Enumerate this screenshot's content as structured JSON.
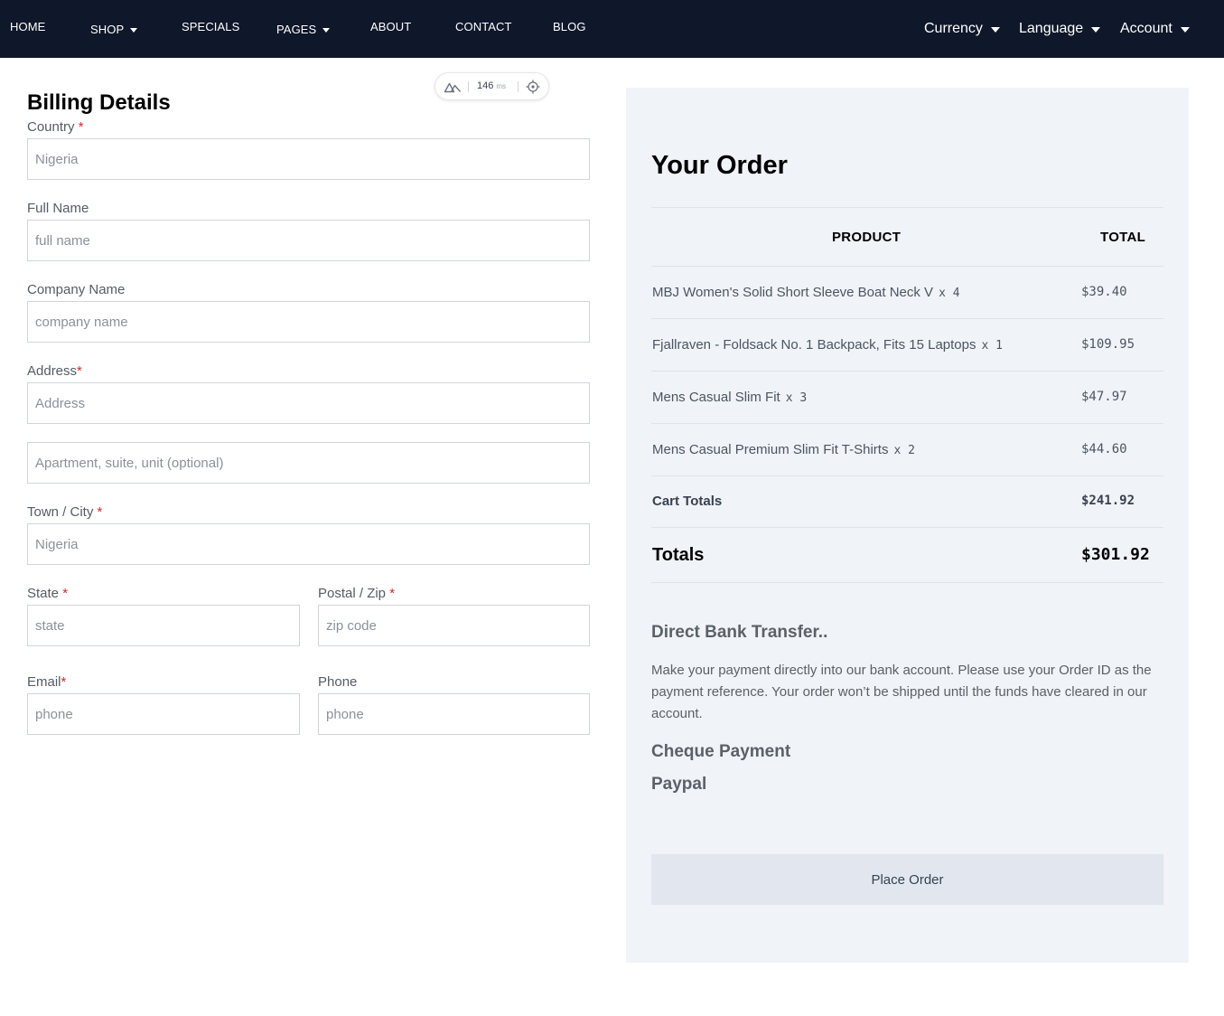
{
  "nav": {
    "items": [
      {
        "label": "HOME",
        "has_dropdown": false
      },
      {
        "label": "SHOP",
        "has_dropdown": true
      },
      {
        "label": "SPECIALS",
        "has_dropdown": false
      },
      {
        "label": "PAGES",
        "has_dropdown": true
      },
      {
        "label": "ABOUT",
        "has_dropdown": false
      },
      {
        "label": "CONTACT",
        "has_dropdown": false
      },
      {
        "label": "BLOG",
        "has_dropdown": false
      }
    ],
    "right": [
      {
        "label": "Currency"
      },
      {
        "label": "Language"
      },
      {
        "label": "Account"
      }
    ]
  },
  "devtools": {
    "timing_value": "146",
    "timing_unit": "ms"
  },
  "billing": {
    "title": "Billing Details",
    "country": {
      "label": "Country",
      "required_mark": "*",
      "placeholder": "Nigeria"
    },
    "full_name": {
      "label": "Full Name",
      "placeholder": "full name"
    },
    "company": {
      "label": "Company Name",
      "placeholder": "company name"
    },
    "address": {
      "label": "Address",
      "required_mark": "*",
      "placeholder": "Address",
      "line2_placeholder": "Apartment, suite, unit (optional)"
    },
    "city": {
      "label": "Town / City",
      "required_mark": "*",
      "placeholder": "Nigeria"
    },
    "state": {
      "label": "State",
      "required_mark": "*",
      "placeholder": "state"
    },
    "postal": {
      "label": "Postal / Zip",
      "required_mark": "*",
      "placeholder": "zip code"
    },
    "email": {
      "label": "Email",
      "required_mark": "*",
      "placeholder": "phone"
    },
    "phone": {
      "label": "Phone",
      "placeholder": "phone"
    }
  },
  "order": {
    "title": "Your Order",
    "col_product": "PRODUCT",
    "col_total": "TOTAL",
    "items": [
      {
        "name": "MBJ Women's Solid Short Sleeve Boat Neck V",
        "qty": "x 4",
        "price": "$39.40"
      },
      {
        "name": "Fjallraven - Foldsack No. 1 Backpack, Fits 15 Laptops",
        "qty": "x 1",
        "price": "$109.95"
      },
      {
        "name": "Mens Casual Slim Fit",
        "qty": "x 3",
        "price": "$47.97"
      },
      {
        "name": "Mens Casual Premium Slim Fit T-Shirts",
        "qty": "x 2",
        "price": "$44.60"
      }
    ],
    "cart_totals_label": "Cart Totals",
    "cart_totals_value": "$241.92",
    "totals_label": "Totals",
    "totals_value": "$301.92"
  },
  "payment": {
    "bank_title": "Direct Bank Transfer..",
    "bank_desc": "Make your payment directly into our bank account. Please use your Order ID as the payment reference. Your order won’t be shipped until the funds have cleared in our account.",
    "cheque_title": "Cheque Payment",
    "paypal_title": "Paypal"
  },
  "place_order_label": "Place Order"
}
